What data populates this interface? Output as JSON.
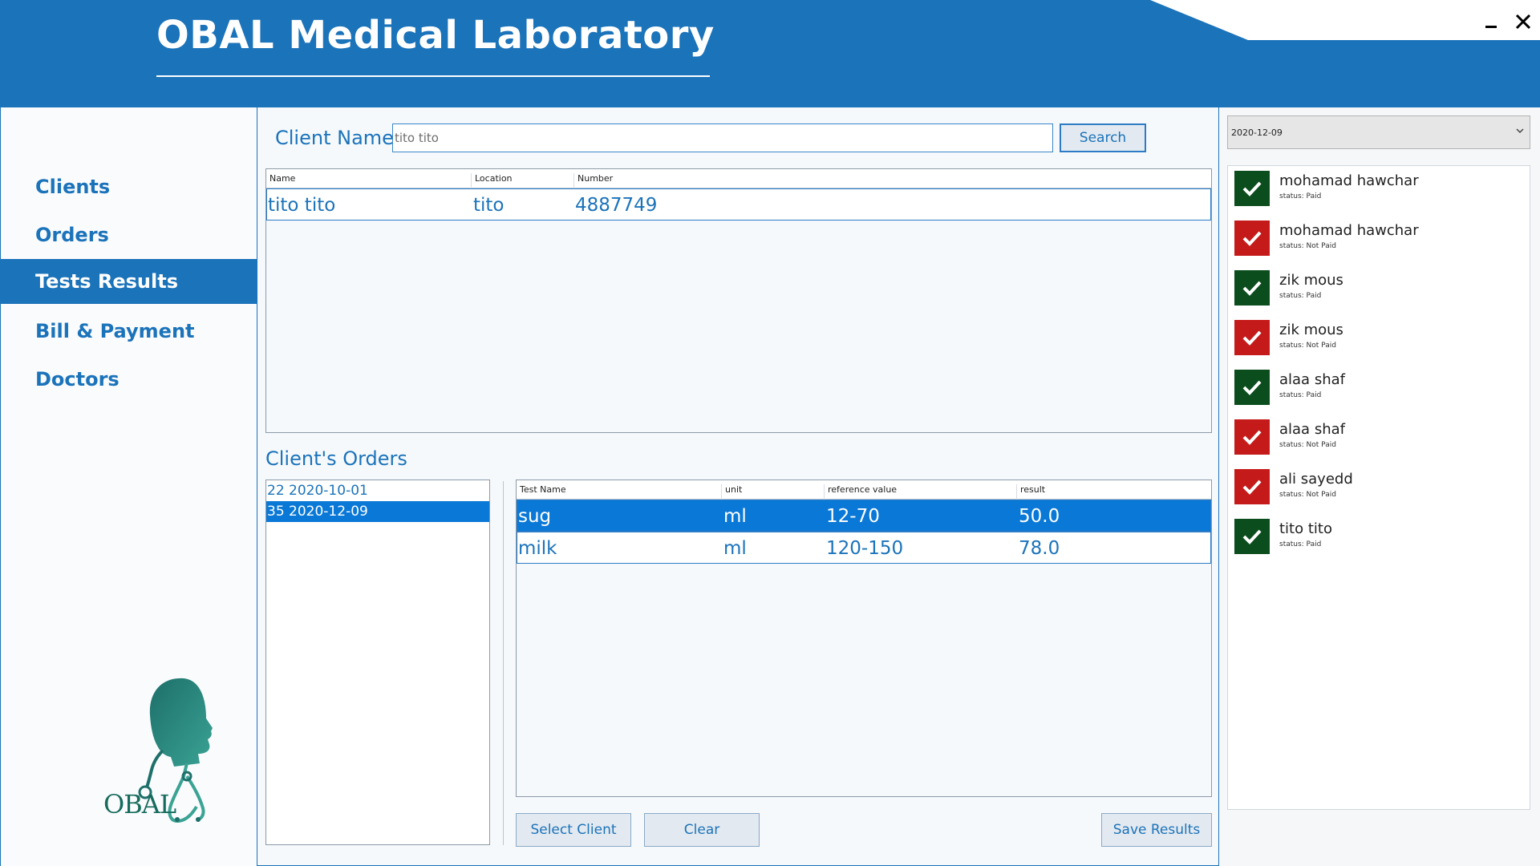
{
  "app": {
    "title": "OBAL Medical Laboratory"
  },
  "window": {
    "minimize_icon": "minimize-icon",
    "close_icon": "close-icon"
  },
  "sidebar": {
    "items": [
      {
        "label": "Clients",
        "active": false
      },
      {
        "label": "Orders",
        "active": false
      },
      {
        "label": "Tests Results",
        "active": true
      },
      {
        "label": "Bill & Payment",
        "active": false
      },
      {
        "label": "Doctors",
        "active": false
      }
    ],
    "logo_text": "OBAL"
  },
  "search": {
    "label": "Client Name",
    "value": "tito tito",
    "button_label": "Search"
  },
  "clients_table": {
    "columns": [
      "Name",
      "Location",
      "Number"
    ],
    "rows": [
      {
        "name": "tito tito",
        "location": "tito",
        "number": "4887749"
      }
    ]
  },
  "orders": {
    "title": "Client's Orders",
    "items": [
      {
        "label": "22 2020-10-01",
        "selected": false
      },
      {
        "label": "35 2020-12-09",
        "selected": true
      }
    ]
  },
  "results_table": {
    "columns": [
      "Test Name",
      "unit",
      "reference value",
      "result"
    ],
    "rows": [
      {
        "test": "sug",
        "unit": "ml",
        "reference": "12-70",
        "result": "50.0",
        "selected": true
      },
      {
        "test": "milk",
        "unit": "ml",
        "reference": "120-150",
        "result": "78.0",
        "selected": false
      }
    ]
  },
  "actions": {
    "select_client": "Select Client",
    "clear": "Clear",
    "save_results": "Save Results"
  },
  "right_panel": {
    "date": "2020-12-09",
    "entries": [
      {
        "name": "mohamad hawchar",
        "status": "status: Paid",
        "paid": true
      },
      {
        "name": "mohamad hawchar",
        "status": "status: Not Paid",
        "paid": false
      },
      {
        "name": "zik mous",
        "status": "status: Paid",
        "paid": true
      },
      {
        "name": "zik mous",
        "status": "status: Not Paid",
        "paid": false
      },
      {
        "name": "alaa shaf",
        "status": "status: Paid",
        "paid": true
      },
      {
        "name": "alaa shaf",
        "status": "status: Not Paid",
        "paid": false
      },
      {
        "name": "ali sayedd",
        "status": "status: Not Paid",
        "paid": false
      },
      {
        "name": "tito tito",
        "status": "status: Paid",
        "paid": true
      }
    ]
  },
  "colors": {
    "primary": "#1b73ba",
    "selected": "#0a78d6",
    "paid": "#0b4d1d",
    "not_paid": "#c51a1a",
    "logo": "#166b5c"
  }
}
